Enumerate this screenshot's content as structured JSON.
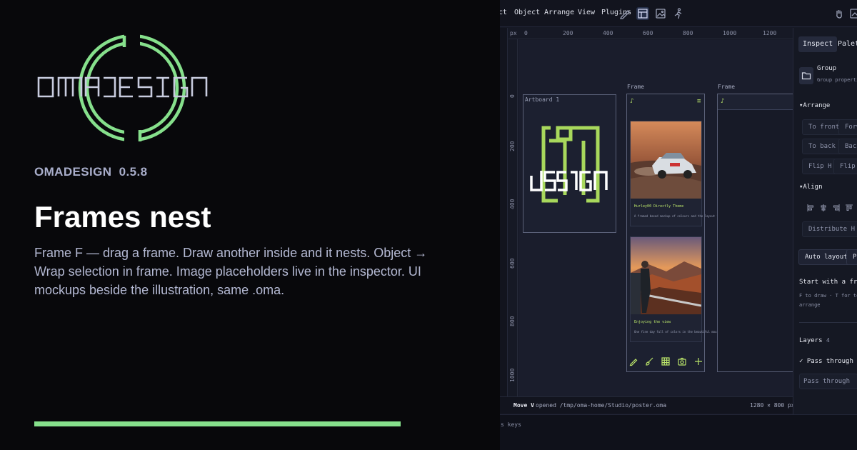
{
  "promo": {
    "logo_text": "OMADESIGN",
    "version_label": "OMADESIGN  0.5.8",
    "headline": "Frames nest",
    "description": "Frame F — drag a frame. Draw another inside and it nests. Object → Wrap selection in frame. Image placeholders live in the inspector. UI mockups beside the illustration, same .oma.",
    "colors": {
      "accent": "#86e08c",
      "background": "#08080b"
    }
  },
  "app": {
    "menu": [
      "ct",
      "Object",
      "Arrange",
      "View",
      "Plugins"
    ],
    "toolbar_icons": [
      "pen-icon",
      "shapes-icon",
      "frame-icon",
      "image-icon",
      "figure-icon",
      "hand-icon",
      "export-icon"
    ],
    "ruler": {
      "unit": "px",
      "x_ticks": [
        "0",
        "200",
        "400",
        "600",
        "800",
        "1000",
        "1200"
      ],
      "y_ticks": [
        "0",
        "200",
        "400",
        "600",
        "800",
        "1000"
      ]
    },
    "canvas": {
      "artboard_label": "Artboard 1",
      "artboard_logo_text": "design",
      "frame_a_label": "Frame",
      "frame_b_label": "Frame",
      "cards": [
        {
          "title": "Hurley00 Directly Theme",
          "text": "A framed based mockup of colours and the layout theme"
        },
        {
          "title": "Enjoying the view",
          "text": "One fine day full of colors in the beautiful mountains"
        }
      ]
    },
    "status": {
      "mode": "Move V",
      "message": "opened /tmp/oma-home/Studio/poster.oma",
      "size": "1280 × 800 px",
      "keys": "s keys"
    },
    "inspector": {
      "tabs": [
        "Inspect",
        "Palette"
      ],
      "group_title": "Group",
      "group_subtitle": "Group properties",
      "arrange_title": "▾Arrange",
      "arrange_buttons": [
        "To front",
        "Forward",
        "To back",
        "Backward",
        "Flip H",
        "Flip V"
      ],
      "align_title": "▾Align",
      "distribute_button": "Distribute H",
      "auto_layout_button": "Auto layout",
      "preset_button": "Pr",
      "hint_title": "Start with a frame",
      "hint_line1": "F to draw · T for text",
      "hint_line2": "arrange",
      "layers_title": "Layers",
      "layers_count": "4",
      "blend_checkbox": "✓ Pass through",
      "blend_select": "Pass through"
    }
  }
}
